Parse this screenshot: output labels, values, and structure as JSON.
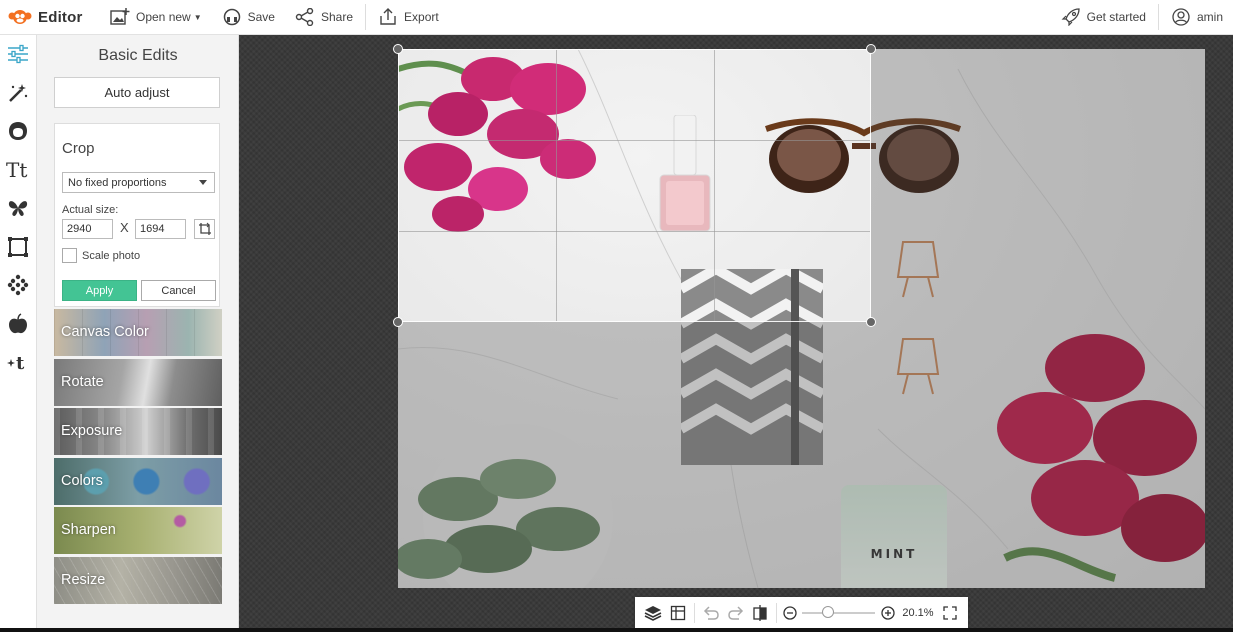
{
  "topbar": {
    "brand": "Editor",
    "open_new": "Open new",
    "save": "Save",
    "share": "Share",
    "export": "Export",
    "get_started": "Get started",
    "user": "amin"
  },
  "rail": {
    "items": [
      "sliders-icon",
      "magic-wand-icon",
      "face-icon",
      "text-icon",
      "butterfly-icon",
      "frame-icon",
      "texture-icon",
      "apple-icon",
      "effects-icon"
    ]
  },
  "panel": {
    "title": "Basic Edits",
    "auto_adjust": "Auto adjust",
    "crop": {
      "title": "Crop",
      "proportion": "No fixed proportions",
      "actual_size_label": "Actual size:",
      "width": "2940",
      "x_label": "X",
      "height": "1694",
      "scale_label": "Scale photo",
      "scale_checked": false,
      "apply": "Apply",
      "cancel": "Cancel"
    },
    "tiles": [
      {
        "label": "Canvas Color"
      },
      {
        "label": "Rotate"
      },
      {
        "label": "Exposure"
      },
      {
        "label": "Colors"
      },
      {
        "label": "Sharpen"
      },
      {
        "label": "Resize"
      }
    ]
  },
  "photo": {
    "notebook_text": "MINT"
  },
  "zoom": {
    "value": "20.1%",
    "level": 0.3
  },
  "colors": {
    "accent": "#43c494",
    "brand_orange": "#f37021",
    "workspace": "#3a3a3a"
  }
}
